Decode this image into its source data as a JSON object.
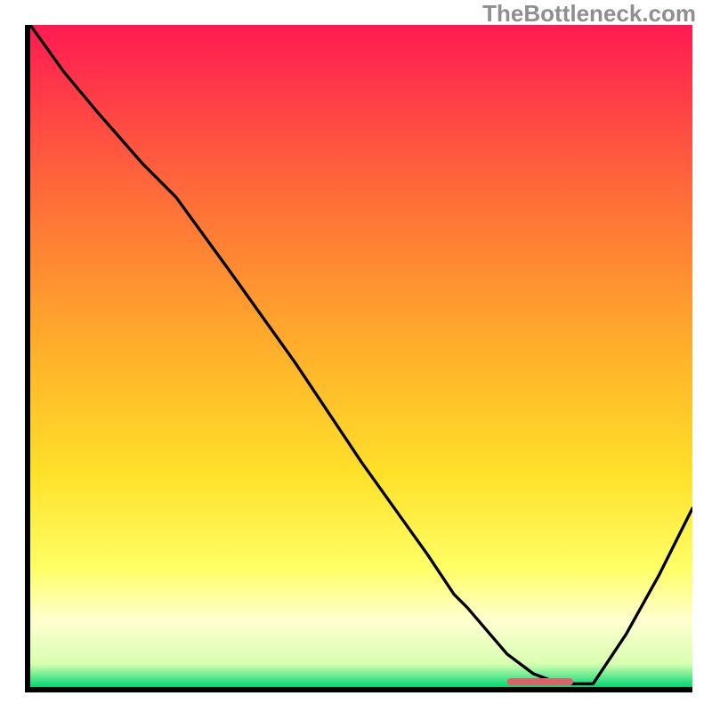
{
  "watermark": "TheBottleneck.com",
  "colors": {
    "axis": "#000000",
    "curve": "#000000",
    "marker": "#d9636a",
    "gradient_stops": [
      {
        "offset": 0.0,
        "color": "#ff1a52"
      },
      {
        "offset": 0.25,
        "color": "#ff6a3a"
      },
      {
        "offset": 0.5,
        "color": "#ffb22a"
      },
      {
        "offset": 0.68,
        "color": "#ffe12a"
      },
      {
        "offset": 0.82,
        "color": "#ffff66"
      },
      {
        "offset": 0.9,
        "color": "#ffffd0"
      },
      {
        "offset": 0.965,
        "color": "#d8ffb0"
      },
      {
        "offset": 1.0,
        "color": "#00d873"
      }
    ]
  },
  "chart_data": {
    "type": "line",
    "title": "",
    "xlabel": "",
    "ylabel": "",
    "xlim": [
      0,
      100
    ],
    "ylim": [
      0,
      100
    ],
    "grid": false,
    "legend": false,
    "x": [
      0,
      5,
      10,
      17,
      22,
      30,
      40,
      50,
      60,
      64,
      66,
      72,
      76,
      80,
      82,
      85,
      90,
      95,
      100
    ],
    "values": [
      100,
      93,
      87,
      79,
      74,
      63,
      49,
      34,
      20,
      14,
      12,
      5,
      2,
      0.5,
      0.5,
      0.5,
      8,
      17,
      27
    ],
    "marker": {
      "x_start": 72,
      "x_end": 82,
      "y": 0.8
    }
  }
}
